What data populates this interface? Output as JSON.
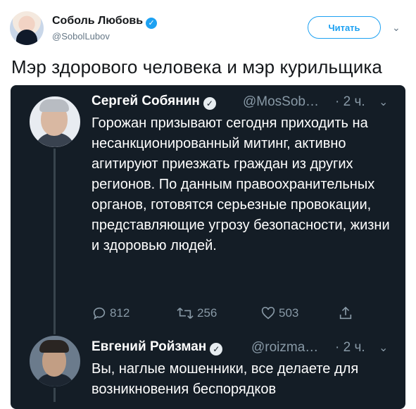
{
  "author": {
    "name": "Соболь Любовь",
    "handle": "@SobolLubov",
    "verified_icon": "verified-badge-icon"
  },
  "follow_button": {
    "label": "Читать"
  },
  "more_icon": "chevron-down-icon",
  "tweet": {
    "text": "Мэр здорового человека и мэр курильщика"
  },
  "embedded": {
    "first": {
      "name": "Сергей Собянин",
      "handle": "@MosSob…",
      "time": "· 2 ч.",
      "text": "Горожан призывают сегодня приходить на несанкционированный митинг, активно агитируют приезжать граждан из других регионов. По данным правоохранительных органов, готовятся серьезные провокации, представляющие угрозу безопасности, жизни и здоровью людей.",
      "reply_count": "812",
      "retweet_count": "256",
      "like_count": "503"
    },
    "second": {
      "name": "Евгений Ройзман",
      "handle": "@roizma…",
      "time": "· 2 ч.",
      "text": "Вы, наглые мошенники, все делаете для возникновения беспорядков"
    }
  },
  "colors": {
    "accent": "#1da1f2",
    "dark_bg": "#141d26",
    "muted": "#8899a6"
  }
}
